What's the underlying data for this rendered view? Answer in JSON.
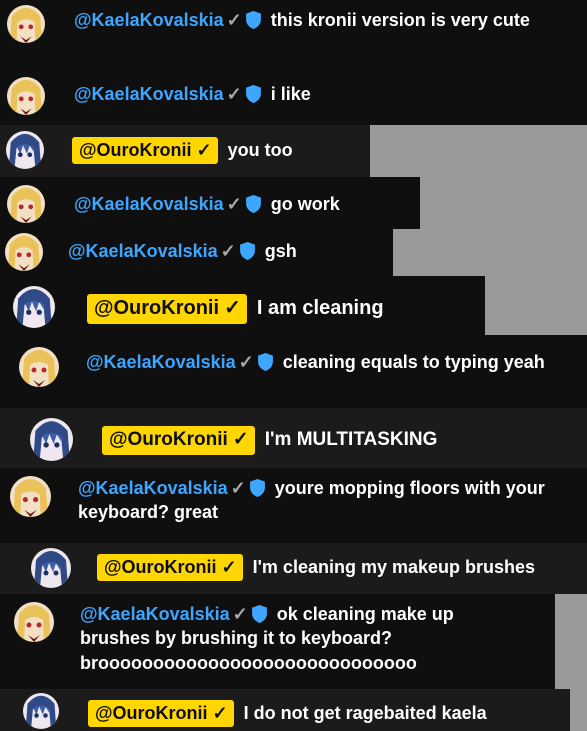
{
  "authors": {
    "kaela": "@KaelaKovalskia",
    "kronii": "@OuroKronii",
    "verified_mark": "✓"
  },
  "colors": {
    "kaela_name": "#3ea6ff",
    "owner_badge_bg": "#ffd600",
    "moderator_shield": "#3ea6ff",
    "message_bg": "#0f0f0f"
  },
  "icons": {
    "verified": "checkmark-icon",
    "moderator": "shield-icon",
    "kaela_avatar": "blonde-avatar",
    "kronii_avatar": "blue-hair-avatar"
  },
  "messages": [
    {
      "author": "kaela",
      "text": "this kronii version is very cute"
    },
    {
      "author": "kaela",
      "text": "i like"
    },
    {
      "author": "kronii",
      "text": "you too"
    },
    {
      "author": "kaela",
      "text": "go work"
    },
    {
      "author": "kaela",
      "text": "gsh"
    },
    {
      "author": "kronii",
      "text": "I am cleaning"
    },
    {
      "author": "kaela",
      "text": "cleaning equals to typing yeah"
    },
    {
      "author": "kronii",
      "text": "I'm MULTITASKING"
    },
    {
      "author": "kaela",
      "text": "youre mopping floors with your keyboard? great"
    },
    {
      "author": "kronii",
      "text": "I'm cleaning my makeup brushes"
    },
    {
      "author": "kaela",
      "text": "ok cleaning make up brushes by brushing it to keyboard? brooooooooooooooooooooooooooooo"
    },
    {
      "author": "kronii",
      "text": "I do not get ragebaited kaela"
    }
  ]
}
